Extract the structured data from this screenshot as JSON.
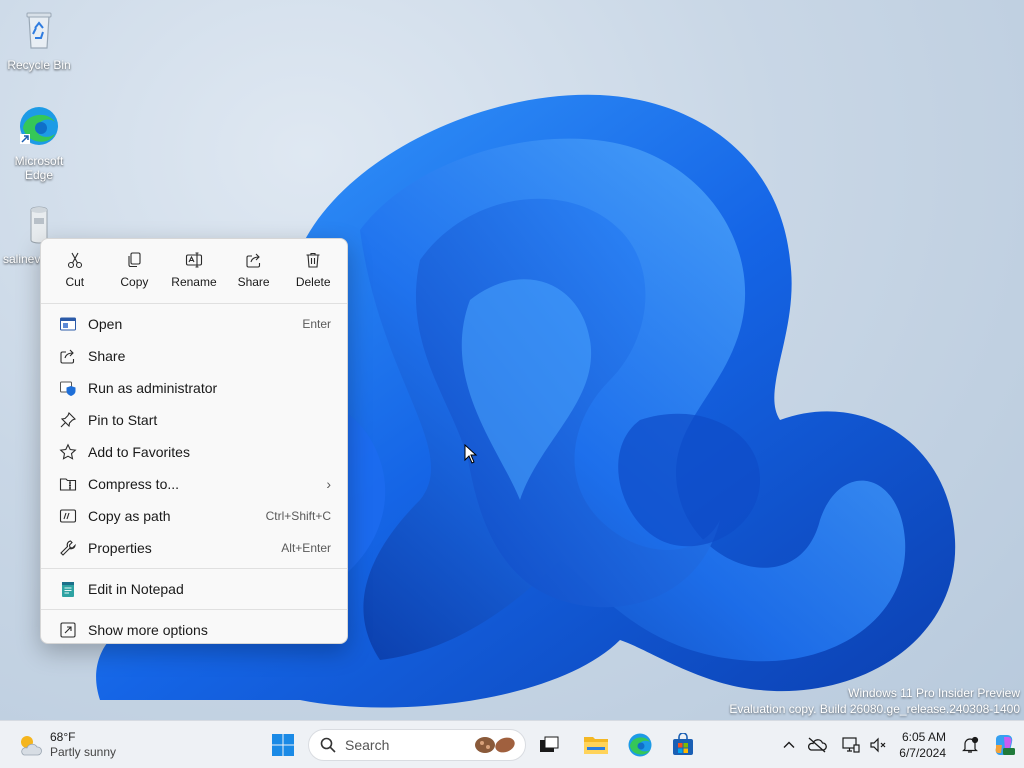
{
  "desktop": {
    "icons": [
      {
        "label": "Recycle Bin",
        "icon": "recycle-bin-icon"
      },
      {
        "label": "Microsoft Edge",
        "icon": "edge-icon"
      },
      {
        "label": "salinev",
        "icon": "text-file-icon"
      }
    ]
  },
  "context_menu": {
    "quick_actions": [
      {
        "label": "Cut",
        "icon": "scissors-icon"
      },
      {
        "label": "Copy",
        "icon": "copy-icon"
      },
      {
        "label": "Rename",
        "icon": "rename-icon"
      },
      {
        "label": "Share",
        "icon": "share-icon"
      },
      {
        "label": "Delete",
        "icon": "trash-icon"
      }
    ],
    "items": [
      {
        "label": "Open",
        "shortcut": "Enter",
        "icon": "open-window-icon"
      },
      {
        "label": "Share",
        "shortcut": "",
        "icon": "share-icon"
      },
      {
        "label": "Run as administrator",
        "shortcut": "",
        "icon": "shield-icon"
      },
      {
        "label": "Pin to Start",
        "shortcut": "",
        "icon": "pin-icon"
      },
      {
        "label": "Add to Favorites",
        "shortcut": "",
        "icon": "star-icon"
      },
      {
        "label": "Compress to...",
        "shortcut": "",
        "submenu": true,
        "icon": "zip-folder-icon"
      },
      {
        "label": "Copy as path",
        "shortcut": "Ctrl+Shift+C",
        "icon": "path-icon"
      },
      {
        "label": "Properties",
        "shortcut": "Alt+Enter",
        "icon": "wrench-icon"
      }
    ],
    "extra_items": [
      {
        "label": "Edit in Notepad",
        "icon": "notepad-icon"
      }
    ],
    "more": {
      "label": "Show more options",
      "icon": "more-options-icon"
    }
  },
  "watermark": {
    "line1": "Windows 11 Pro Insider Preview",
    "line2": "Evaluation copy. Build 26080.ge_release.240308-1400"
  },
  "taskbar": {
    "weather": {
      "temp": "68°F",
      "desc": "Partly sunny",
      "icon": "partly-sunny-icon"
    },
    "search_placeholder": "Search",
    "pinned": [
      "start-icon",
      "task-view-icon",
      "file-explorer-icon",
      "edge-icon",
      "store-icon"
    ],
    "clock": {
      "time": "6:05 AM",
      "date": "6/7/2024"
    }
  },
  "colors": {
    "accent": "#0067c0",
    "menu_bg": "#f9f9f9"
  }
}
